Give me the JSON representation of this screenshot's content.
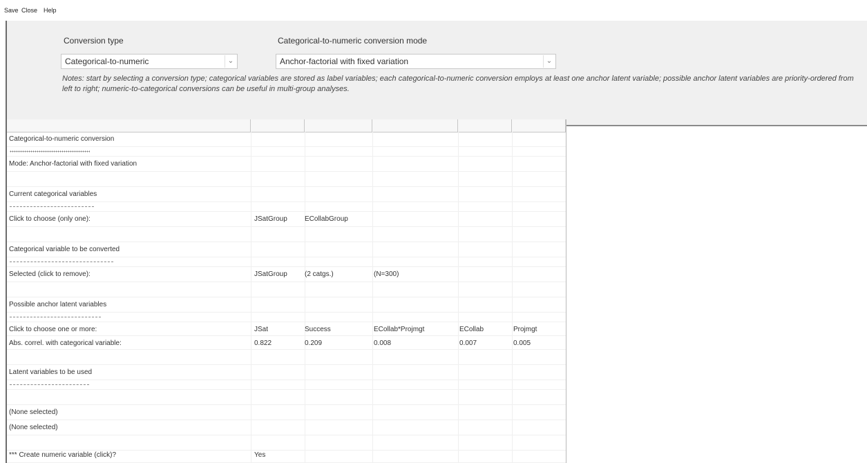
{
  "menu": {
    "save": "Save",
    "close": "Close",
    "help": "Help"
  },
  "panel": {
    "conversion_type_label": "Conversion type",
    "conversion_type_value": "Categorical-to-numeric",
    "mode_label": "Categorical-to-numeric conversion mode",
    "mode_value": "Anchor-factorial with fixed variation",
    "notes": "Notes: start by selecting a conversion type; categorical variables are stored as label variables; each categorical-to-numeric conversion employs at least one anchor latent variable; possible anchor latent variables are priority-ordered from left to right; numeric-to-categorical conversions can be useful in multi-group analyses."
  },
  "grid": {
    "title": "Categorical-to-numeric conversion",
    "mode": "Mode: Anchor-factorial with fixed variation",
    "current_header": "Current categorical variables",
    "click_choose_label": "Click to choose (only one):",
    "current_vars": [
      "JSatGroup",
      "ECollabGroup"
    ],
    "to_convert_header": "Categorical variable to be converted",
    "selected_label": "Selected (click to remove):",
    "selected_var": "JSatGroup",
    "selected_catgs": "(2 catgs.)",
    "selected_n": "(N=300)",
    "anchor_header": "Possible anchor latent variables",
    "choose_more_label": "Click to choose one or more:",
    "anchor_vars": [
      "JSat",
      "Success",
      "ECollab*Projmgt",
      "ECollab",
      "Projmgt"
    ],
    "abs_correl_label": "Abs. correl. with categorical variable:",
    "abs_correl_values": [
      "0.822",
      "0.209",
      "0.008",
      "0.007",
      "0.005"
    ],
    "latent_header": "Latent variables to be used",
    "none_selected_1": "(None selected)",
    "none_selected_2": "(None selected)",
    "create_label": "*** Create numeric variable (click)?",
    "create_value": "Yes"
  }
}
